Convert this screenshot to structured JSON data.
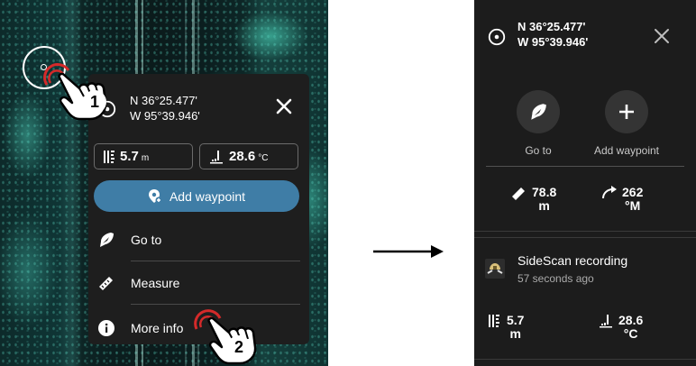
{
  "left_screen": {
    "popup": {
      "lat": "N 36°25.477'",
      "lon": "W 95°39.946'",
      "depth": {
        "value": "5.7",
        "unit": "m"
      },
      "temperature": {
        "value": "28.6",
        "unit": "°C"
      },
      "add_waypoint_label": "Add waypoint",
      "menu_items": [
        {
          "label": "Go to",
          "icon": "navigate-icon"
        },
        {
          "label": "Measure",
          "icon": "ruler-icon"
        },
        {
          "label": "More info",
          "icon": "info-icon"
        }
      ]
    },
    "step_badges": [
      "1",
      "2"
    ]
  },
  "right_screen": {
    "lat": "N 36°25.477'",
    "lon": "W 95°39.946'",
    "actions": [
      {
        "label": "Go to",
        "icon": "navigate-icon"
      },
      {
        "label": "Add waypoint",
        "icon": "plus-icon"
      }
    ],
    "distance": {
      "value": "78.8",
      "unit": "m"
    },
    "bearing": {
      "value": "262",
      "unit": "°M"
    },
    "recording": {
      "title": "SideScan recording",
      "time": "57 seconds ago"
    },
    "depth": {
      "value": "5.7",
      "unit": "m"
    },
    "temperature": {
      "value": "28.6",
      "unit": "°C"
    }
  },
  "colors": {
    "popup_bg": "#1e1e1e",
    "panel_bg": "#1c1c1c",
    "button_blue": "#3f7da6",
    "sonar_teal": "#46c8af",
    "tap_red": "#d42a2a"
  }
}
